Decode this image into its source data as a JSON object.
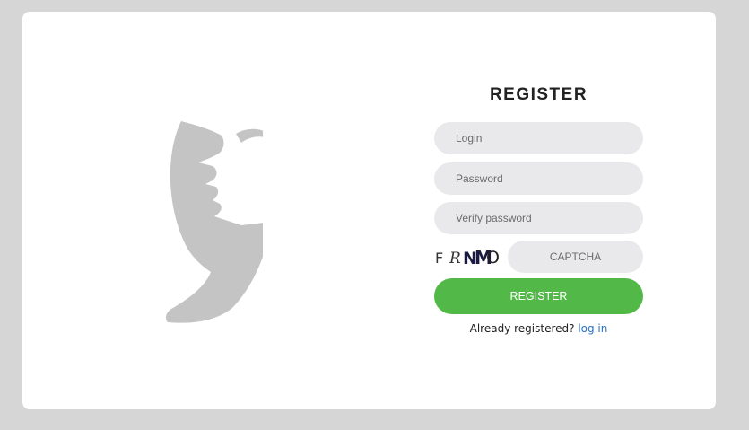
{
  "register_form": {
    "title": "REGISTER",
    "login_placeholder": "Login",
    "password_placeholder": "Password",
    "verify_password_placeholder": "Verify password",
    "captcha_placeholder": "CAPTCHA",
    "captcha_chars": [
      "F",
      "R",
      "N",
      "M",
      "O"
    ],
    "submit_label": "REGISTER",
    "already_registered_text": "Already registered?",
    "login_link_label": "log in"
  },
  "colors": {
    "page_background": "#d6d6d6",
    "card_background": "#ffffff",
    "input_background": "#e9e9eb",
    "primary_button": "#52b848",
    "link": "#2a72c4",
    "logo_gray": "#c4c4c4"
  },
  "icons": {
    "logo": "face-profile-icon"
  }
}
